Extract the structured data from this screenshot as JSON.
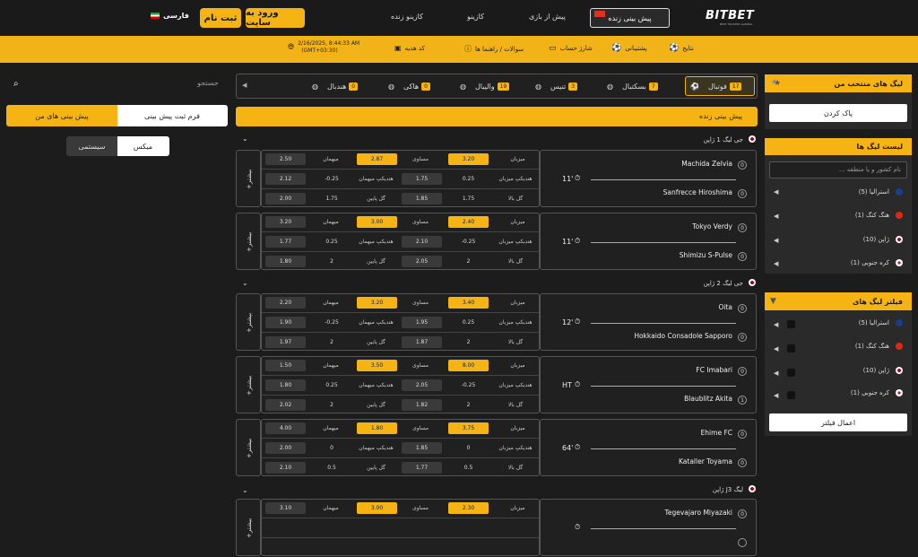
{
  "brand": {
    "logo": "BITBET",
    "tagline": "BEST TRUSTED GAMING"
  },
  "nav": {
    "live_prematch": "پیش بینی زنده",
    "prematch": "پیش از بازی",
    "casino": "کازینو",
    "live_casino": "کازینو زنده"
  },
  "auth": {
    "login": "ورود به سایت",
    "register": "ثبت نام",
    "language": "فارسی"
  },
  "subnav": {
    "results": "نتایج",
    "support": "پشتیبانی",
    "deposit": "شارژ حساب",
    "faq": "سوالات / راهنما ها",
    "gift_code": "کد هدیه",
    "datetime": "2/16/2025, 8:44:33 AM",
    "timezone": "(GMT+03:30)"
  },
  "right": {
    "fav_title": "لیگ های منتخب من",
    "clear": "پاک کردن",
    "leagues_title": "لیست لیگ ها",
    "search_placeholder": "نام کشور و یا منطقه ...",
    "leagues": [
      "استرالیا (5)",
      "هنگ کنگ (1)",
      "ژاپن (10)",
      "کره جنوبی (1)"
    ],
    "filter_title": "فیلتر لیگ های",
    "filter_items": [
      "استرالیا (5)",
      "هنگ کنگ (1)",
      "ژاپن (10)",
      "کره جنوبی (1)"
    ],
    "apply": "اعمال فیلتر"
  },
  "sports": [
    {
      "name": "فوتبال",
      "count": "17"
    },
    {
      "name": "بسکتبال",
      "count": "7"
    },
    {
      "name": "تنیس",
      "count": "3"
    },
    {
      "name": "والیبال",
      "count": "19"
    },
    {
      "name": "هاکی",
      "count": "0"
    },
    {
      "name": "هندبال",
      "count": "0"
    }
  ],
  "live_header": "پیش بینی زنده",
  "leagues": [
    "جی لیگ 1 ژاپن",
    "جی لیگ 2 ژاپن",
    "لیگ J3 ژاپن"
  ],
  "odds_labels": {
    "home": "میزبان",
    "draw": "مساوی",
    "away": "میهمان",
    "hcp_home": "هندیکپ میزبان",
    "hcp_away": "هندیکپ میهمان",
    "over": "گل بالا",
    "under": "گل پایین",
    "more": "+بیشتر"
  },
  "matches": [
    {
      "home": "Machida Zelvia",
      "away": "Sanfrecce Hiroshima",
      "hs": "0",
      "as": "0",
      "time": "11'",
      "o": [
        "3.20",
        "2.87",
        "2.50",
        "0.25",
        "1.75",
        "-0.25",
        "2.12",
        "1.75",
        "1.85",
        "1.75",
        "2.00"
      ]
    },
    {
      "home": "Tokyo Verdy",
      "away": "Shimizu S-Pulse",
      "hs": "0",
      "as": "0",
      "time": "11'",
      "o": [
        "2.40",
        "3.00",
        "3.20",
        "-0.25",
        "2.10",
        "0.25",
        "1.77",
        "2",
        "2.05",
        "2",
        "1.80"
      ]
    },
    {
      "home": "Oita",
      "away": "Hokkaido Consadole Sapporo",
      "hs": "0",
      "as": "0",
      "time": "12'",
      "o": [
        "3.40",
        "3.20",
        "2.20",
        "0.25",
        "1.95",
        "-0.25",
        "1.90",
        "2",
        "1.87",
        "2",
        "1.97"
      ]
    },
    {
      "home": "FC Imabari",
      "away": "Blaublitz Akita",
      "hs": "0",
      "as": "1",
      "time": "HT",
      "o": [
        "8.00",
        "3.50",
        "1.50",
        "-0.25",
        "2.05",
        "0.25",
        "1.80",
        "2",
        "1.82",
        "2",
        "2.02"
      ]
    },
    {
      "home": "Ehime FC",
      "away": "Kataller Toyama",
      "hs": "0",
      "as": "0",
      "time": "64'",
      "o": [
        "3.75",
        "1.80",
        "4.00",
        "0",
        "1.85",
        "0",
        "2.00",
        "0.5",
        "1.77",
        "0.5",
        "2.10"
      ]
    },
    {
      "home": "Tegevajaro Miyazaki",
      "away": "",
      "hs": "0",
      "as": "",
      "time": "",
      "o": [
        "2.30",
        "3.00",
        "3.10"
      ]
    }
  ],
  "left": {
    "search_label": "جستجو",
    "tab_form": "فرم ثبت پیش بینی",
    "tab_mine": "پیش بینی های من",
    "mode_mix": "میکس",
    "mode_system": "سیستمی"
  },
  "colors": {
    "accent": "#f5b414",
    "bg": "#1c1c1c",
    "panel": "#2a2a2a"
  }
}
